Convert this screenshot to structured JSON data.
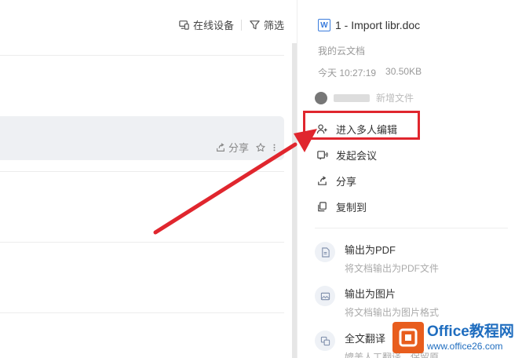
{
  "toolbar": {
    "online_devices": "在线设备",
    "filter": "筛选"
  },
  "file_row": {
    "share": "分享"
  },
  "details": {
    "doc_icon": "W",
    "title": "1 - Import libr.doc",
    "location": "我的云文档",
    "date": "今天 10:27:19",
    "size": "30.50KB",
    "user_action": "新增文件"
  },
  "menu": [
    {
      "label": "进入多人编辑",
      "icon": "user-plus-icon"
    },
    {
      "label": "发起会议",
      "icon": "meeting-icon"
    },
    {
      "label": "分享",
      "icon": "share-icon"
    },
    {
      "label": "复制到",
      "icon": "copy-icon"
    }
  ],
  "features": [
    {
      "title": "输出为PDF",
      "desc": "将文档输出为PDF文件",
      "icon": "pdf-icon"
    },
    {
      "title": "输出为图片",
      "desc": "将文档输出为图片格式",
      "icon": "image-icon"
    },
    {
      "title": "全文翻译",
      "desc": "媲美人工翻译，保留原",
      "icon": "translate-icon"
    }
  ],
  "watermark": {
    "title": "Office教程网",
    "url": "www.office26.com"
  },
  "colors": {
    "highlight": "#e0262e",
    "selected_row": "#eef0f3",
    "brand_blue": "#1f6dbf",
    "brand_orange": "#e85d1d"
  }
}
